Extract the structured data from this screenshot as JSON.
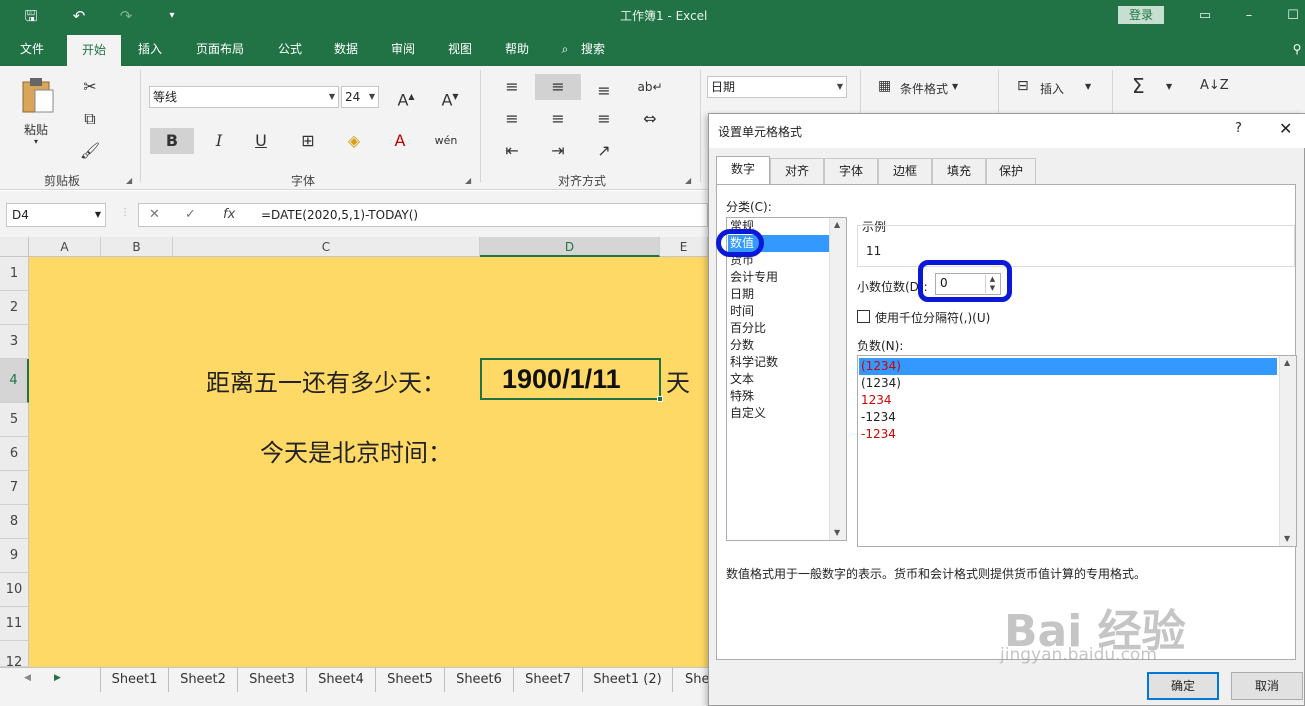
{
  "titlebar": {
    "title": "工作簿1  -  Excel",
    "login": "登录"
  },
  "ribbon_tabs": [
    "文件",
    "开始",
    "插入",
    "页面布局",
    "公式",
    "数据",
    "审阅",
    "视图",
    "帮助",
    "搜索"
  ],
  "ribbon": {
    "paste": "粘贴",
    "clipboard": "剪贴板",
    "font_name": "等线",
    "font_size": "24",
    "font_group": "字体",
    "align_group": "对齐方式",
    "number_format": "日期",
    "cond_format": "条件格式",
    "insert": "插入",
    "bold": "B",
    "italic": "I",
    "underline": "U",
    "sum_icon": "Σ"
  },
  "formula_bar": {
    "name_box": "D4",
    "formula": "=DATE(2020,5,1)-TODAY()",
    "fx": "fx"
  },
  "columns": [
    "A",
    "B",
    "C",
    "D",
    "E"
  ],
  "rows": [
    "1",
    "2",
    "3",
    "4",
    "5",
    "6",
    "7",
    "8",
    "9",
    "10",
    "11",
    "12"
  ],
  "cells": {
    "c4": "距离五一还有多少天：",
    "d4": "1900/1/11",
    "e4": "天",
    "c6": "今天是北京时间："
  },
  "sheets": [
    "Sheet1",
    "Sheet2",
    "Sheet3",
    "Sheet4",
    "Sheet5",
    "Sheet6",
    "Sheet7",
    "Sheet1 (2)",
    "She"
  ],
  "dialog": {
    "title": "设置单元格格式",
    "help": "?",
    "tabs": [
      "数字",
      "对齐",
      "字体",
      "边框",
      "填充",
      "保护"
    ],
    "category_label": "分类(C):",
    "categories": [
      "常规",
      "数值",
      "货币",
      "会计专用",
      "日期",
      "时间",
      "百分比",
      "分数",
      "科学记数",
      "文本",
      "特殊",
      "自定义"
    ],
    "selected_category": "数值",
    "sample_label": "示例",
    "sample_value": "11",
    "decimal_label": "小数位数(D):",
    "decimal_value": "0",
    "thousand_sep": "使用千位分隔符(,)(U)",
    "negative_label": "负数(N):",
    "negatives": [
      "(1234)",
      "(1234)",
      "1234",
      "-1234",
      "-1234"
    ],
    "negative_colors": [
      "#d00000",
      "#222222",
      "#d00000",
      "#222222",
      "#d00000"
    ],
    "description": "数值格式用于一般数字的表示。货币和会计格式则提供货币值计算的专用格式。",
    "ok": "确定",
    "cancel": "取消"
  },
  "watermark": {
    "brand": "Bai 经验",
    "url": "jingyan.baidu.com"
  },
  "colors": {
    "excel_green": "#217346",
    "cell_fill": "#ffd966",
    "selection_blue": "#3399ff",
    "annotation_blue": "#0a18d8"
  }
}
